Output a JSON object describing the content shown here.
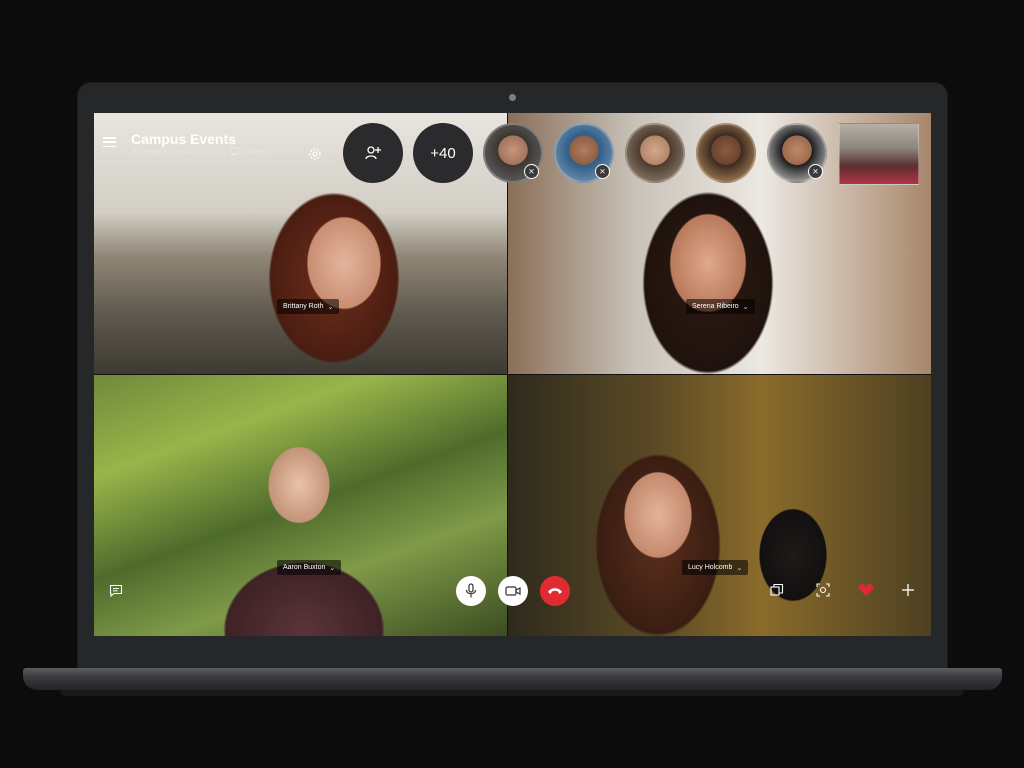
{
  "call": {
    "title": "Campus Events",
    "people_count": "50 people in the call",
    "duration": "13:21",
    "separator": "|",
    "view_mode": "Gallery"
  },
  "top_controls": {
    "add_people_icon": "add-person-icon",
    "more_participants_label": "+40",
    "settings_icon": "gear-icon"
  },
  "participants_strip": [
    {
      "muted": true
    },
    {
      "muted": true
    },
    {
      "muted": false
    },
    {
      "muted": false
    },
    {
      "muted": true
    }
  ],
  "tiles": [
    {
      "name": "Brittany Roth"
    },
    {
      "name": "Serena Ribeiro"
    },
    {
      "name": "Aaron Buxton"
    },
    {
      "name": "Lucy Holcomb"
    }
  ],
  "bottom_controls": {
    "chat_icon": "chat-icon",
    "mic_icon": "microphone-icon",
    "video_icon": "video-camera-icon",
    "end_call_icon": "hang-up-icon",
    "share_icon": "switch-screen-icon",
    "snapshot_icon": "snapshot-icon",
    "react_icon": "heart-icon",
    "more_icon": "plus-icon"
  },
  "colors": {
    "end_call": "#e12b32",
    "heart": "#e1263a",
    "button_dark": "#2b2b2e"
  }
}
